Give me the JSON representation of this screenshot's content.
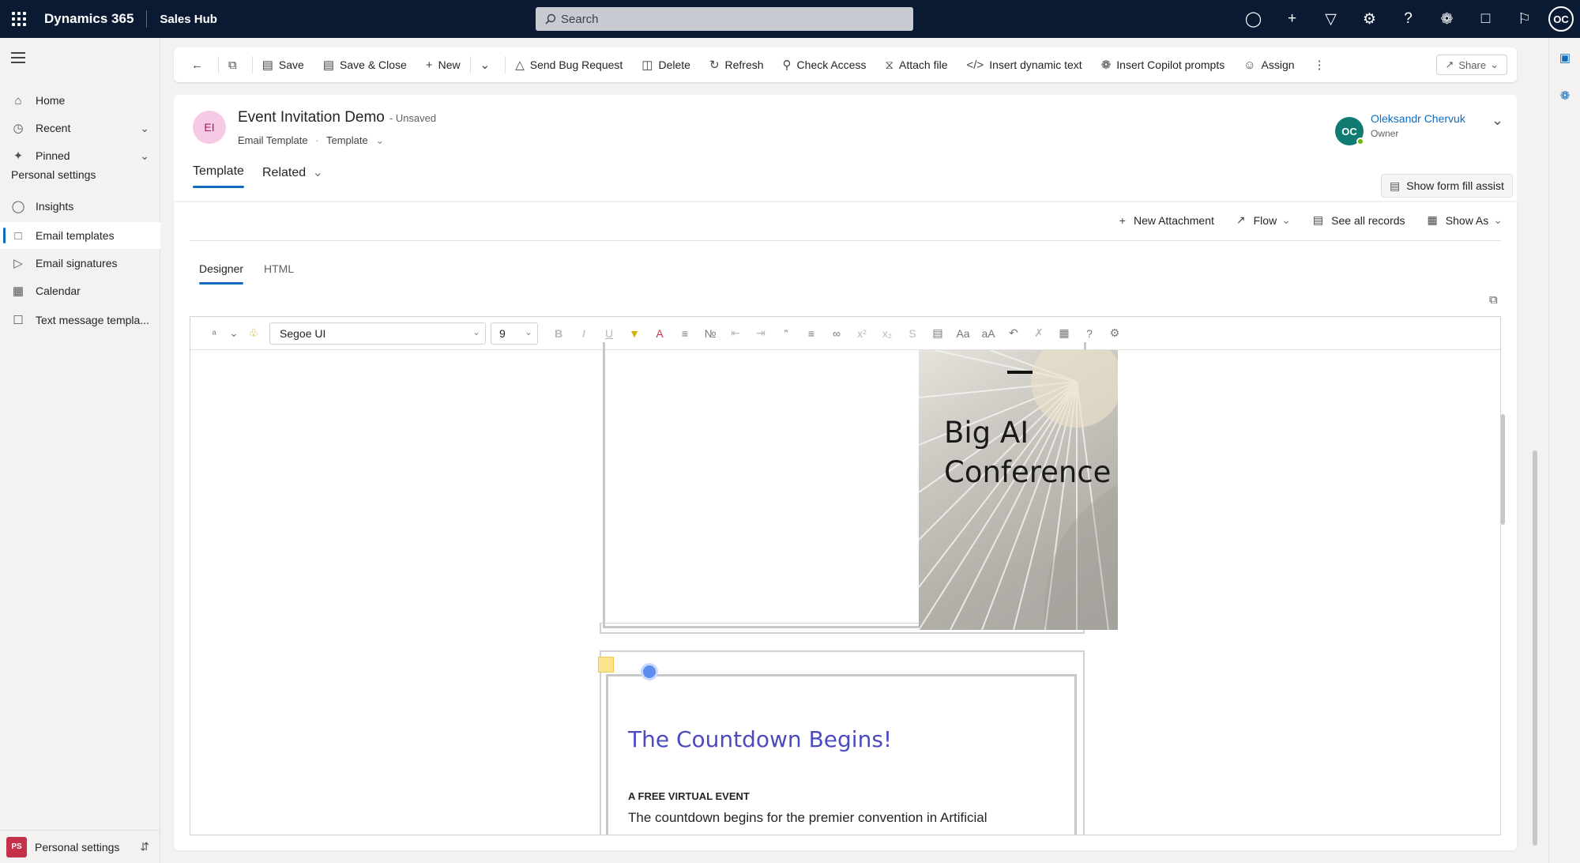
{
  "topbar": {
    "brand": "Dynamics 365",
    "app": "Sales Hub",
    "search_placeholder": "Search",
    "user_initials": "OC"
  },
  "nav": {
    "items": [
      {
        "label": "Home"
      },
      {
        "label": "Recent"
      },
      {
        "label": "Pinned"
      }
    ],
    "section": "Personal settings",
    "settings_items": [
      {
        "label": "Insights"
      },
      {
        "label": "Email templates"
      },
      {
        "label": "Email signatures"
      },
      {
        "label": "Calendar"
      },
      {
        "label": "Text message templa..."
      }
    ],
    "area": {
      "badge": "PS",
      "label": "Personal settings"
    }
  },
  "commandbar": {
    "save": "Save",
    "save_close": "Save & Close",
    "new": "New",
    "send_bug": "Send Bug Request",
    "delete": "Delete",
    "refresh": "Refresh",
    "check_access": "Check Access",
    "attach_file": "Attach file",
    "insert_dynamic": "Insert dynamic text",
    "insert_copilot": "Insert Copilot prompts",
    "assign": "Assign",
    "share": "Share"
  },
  "record": {
    "initials": "EI",
    "title": "Event Invitation Demo",
    "status": "- Unsaved",
    "entity": "Email Template",
    "form": "Template",
    "owner_initials": "OC",
    "owner_name": "Oleksandr Chervuk",
    "owner_role": "Owner"
  },
  "tabs": {
    "template": "Template",
    "related": "Related"
  },
  "form_fill_assist": "Show form fill assist",
  "subgrid": {
    "new_attachment": "New Attachment",
    "flow": "Flow",
    "see_all": "See all records",
    "show_as": "Show As"
  },
  "editor_tabs": {
    "designer": "Designer",
    "html": "HTML"
  },
  "toolbar": {
    "font": "Segoe UI",
    "size": "9"
  },
  "email": {
    "hero_line1": "Big AI",
    "hero_line2": "Conference",
    "countdown_title": "The Countdown Begins!",
    "event_label": "A FREE VIRTUAL EVENT",
    "body": "The countdown begins for the premier convention in Artificial",
    "accent": "#4b4bc0"
  }
}
